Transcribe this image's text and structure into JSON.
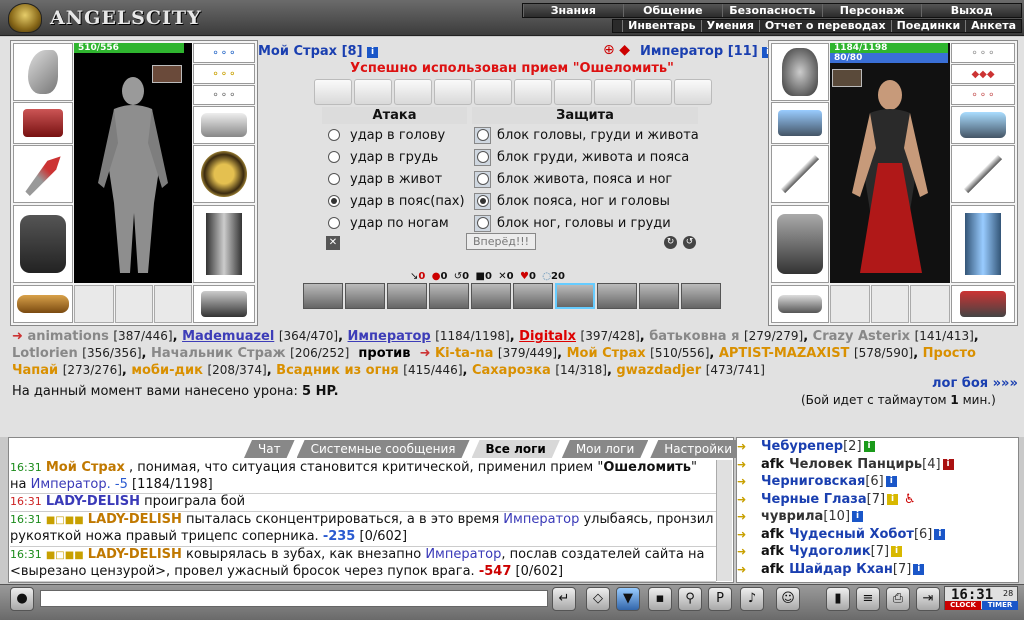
{
  "header": {
    "logo_text": "ANGELSCITY",
    "nav_main": [
      "Знания",
      "Общение",
      "Безопасность",
      "Персонаж",
      "Выход"
    ],
    "nav_sub": [
      "Инвентарь",
      "Умения",
      "Отчет о переводах",
      "Поединки",
      "Анкета"
    ]
  },
  "player": {
    "name": "Мой Страх",
    "level": "[8]",
    "hp": "510/556",
    "hp_fraction": 0.917
  },
  "opponent": {
    "name": "Император",
    "level": "[11]",
    "hp": "1184/1198",
    "mana": "80/80",
    "hp_fraction": 0.988
  },
  "battle": {
    "success_message": "Успешно использован прием \"Ошеломить\"",
    "attack_title": "Атака",
    "defense_title": "Защита",
    "attacks": [
      "удар в голову",
      "удар в грудь",
      "удар в живот",
      "удар в пояс(пах)",
      "удар по ногам"
    ],
    "attack_selected": 3,
    "blocks": [
      "блок головы, груди и живота",
      "блок груди, живота и пояса",
      "блок живота, пояса и ног",
      "блок пояса, ног и головы",
      "блок ног, головы и груди"
    ],
    "block_selected": 3,
    "forward_label": "Вперёд!!!",
    "stats": [
      "0",
      "0",
      "0",
      "0",
      "0",
      "0",
      "20"
    ]
  },
  "teams": {
    "team1": [
      {
        "name": "animations",
        "hp": "[387/446]"
      },
      {
        "name": "Mademuazel",
        "hp": "[364/470]"
      },
      {
        "name": "Император",
        "hp": "[1184/1198]"
      },
      {
        "name": "Digitalx",
        "hp": "[397/428]"
      },
      {
        "name": "батьковна я",
        "hp": "[279/279]"
      },
      {
        "name": "Crazy Asterix",
        "hp": "[141/413]"
      },
      {
        "name": "Lotlorien",
        "hp": "[356/356]"
      },
      {
        "name": "Начальник Страж",
        "hp": "[206/252]"
      }
    ],
    "vs": "против",
    "team2": [
      {
        "name": "Ki-ta-na",
        "hp": "[379/449]"
      },
      {
        "name": "Мой Страх",
        "hp": "[510/556]"
      },
      {
        "name": "APTIST-MAZAXIST",
        "hp": "[578/590]"
      },
      {
        "name": "Просто Чапай",
        "hp": "[273/276]"
      },
      {
        "name": "моби-дик",
        "hp": "[208/374]"
      },
      {
        "name": "Всадник из огня",
        "hp": "[415/446]"
      },
      {
        "name": "Сахарозка",
        "hp": "[14/318]"
      },
      {
        "name": "gwazdadjer",
        "hp": "[473/741]"
      }
    ]
  },
  "damage": {
    "label": "На данный момент вами нанесено урона:",
    "value": "5 HP."
  },
  "log_link": "лог боя »»»",
  "timeout": {
    "prefix": "(Бой идет с таймаутом ",
    "value": "1",
    "suffix": " мин.)"
  },
  "chat": {
    "tabs": [
      "Чат",
      "Системные сообщения",
      "Все логи",
      "Мои логи",
      "Настройки"
    ],
    "active_tab": 2,
    "lines": [
      {
        "time": "16:31",
        "actor": "Мой Страх",
        "text": " , понимая, что ситуация становится критической, применил прием \"",
        "bold": "Ошеломить",
        "text2": "\" на ",
        "target": "Император",
        "dmg": ". -5",
        "hp": " [1184/1198]"
      },
      {
        "time": "16:31",
        "actor": "LADY-DELISH",
        "text": " проиграла бой"
      },
      {
        "time": "16:31",
        "actor": "LADY-DELISH",
        "text": " пыталась сконцентрироваться, а в это время ",
        "target": "Император",
        "text2": " улыбаясь, пронзил рукояткой ножа правый трицепс соперника. ",
        "dmg": "-235",
        "hp": " [0/602]"
      },
      {
        "time": "16:31",
        "actor": "LADY-DELISH",
        "text": " ковырялась в зубах, как внезапно ",
        "target": "Император",
        "text2": ", послав создателей сайта на <вырезано цензурой>, провел ужасный бросок через пупок врага. ",
        "dmg": "-547",
        "hp": " [0/602]"
      }
    ]
  },
  "users": [
    {
      "afk": "",
      "name": "Чебурепер",
      "level": "[2]"
    },
    {
      "afk": "afk",
      "name": "Человек Панцирь",
      "level": "[4]"
    },
    {
      "afk": "",
      "name": "Черниговская",
      "level": "[6]"
    },
    {
      "afk": "",
      "name": "Черные Глаза",
      "level": "[7]"
    },
    {
      "afk": "",
      "name": "чуврила",
      "level": "[10]"
    },
    {
      "afk": "afk",
      "name": "Чудесный Хобот",
      "level": "[6]"
    },
    {
      "afk": "afk",
      "name": "Чудоголик",
      "level": "[7]"
    },
    {
      "afk": "afk",
      "name": "Шайдар Кхан",
      "level": "[7]"
    }
  ],
  "clock": {
    "time": "16:31",
    "sec": "28",
    "clock_label": "CLOCK",
    "timer_label": "TIMER"
  }
}
